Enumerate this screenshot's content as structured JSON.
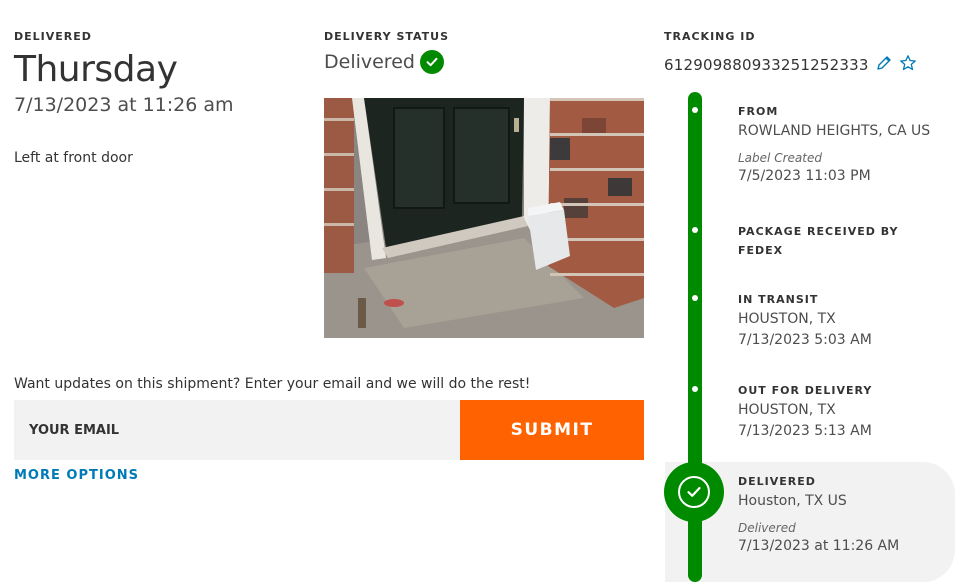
{
  "delivered": {
    "label": "DELIVERED",
    "day": "Thursday",
    "datetime": "7/13/2023 at 11:26 am",
    "note": "Left at front door"
  },
  "status": {
    "label": "DELIVERY STATUS",
    "value": "Delivered",
    "icon": "check-circle-icon",
    "color": "#008a00"
  },
  "tracking": {
    "label": "TRACKING ID",
    "number": "612909880933251252333",
    "edit_icon": "pencil-icon",
    "favorite_icon": "star-icon"
  },
  "photo": {
    "alt": "Delivery photo"
  },
  "updates": {
    "prompt": "Want updates on this shipment? Enter your email and we will do the rest!",
    "email_placeholder": "YOUR EMAIL",
    "email_value": "",
    "submit_label": "SUBMIT",
    "more_options_label": "MORE OPTIONS"
  },
  "colors": {
    "accent_orange": "#ff6200",
    "link_blue": "#007ab7",
    "timeline_green": "#008a00"
  },
  "timeline": {
    "events": [
      {
        "title": "FROM",
        "line1": "ROWLAND HEIGHTS, CA US",
        "sub": "Label Created",
        "line2": "7/5/2023 11:03 PM"
      },
      {
        "title": "PACKAGE RECEIVED BY FEDEX"
      },
      {
        "title": "IN TRANSIT",
        "line1": "HOUSTON, TX",
        "line2": "7/13/2023 5:03 AM"
      },
      {
        "title": "OUT FOR DELIVERY",
        "line1": "HOUSTON, TX",
        "line2": "7/13/2023 5:13 AM"
      },
      {
        "title": "DELIVERED",
        "line1": "Houston, TX US",
        "sub": "Delivered",
        "line2": "7/13/2023 at 11:26 AM"
      }
    ]
  }
}
